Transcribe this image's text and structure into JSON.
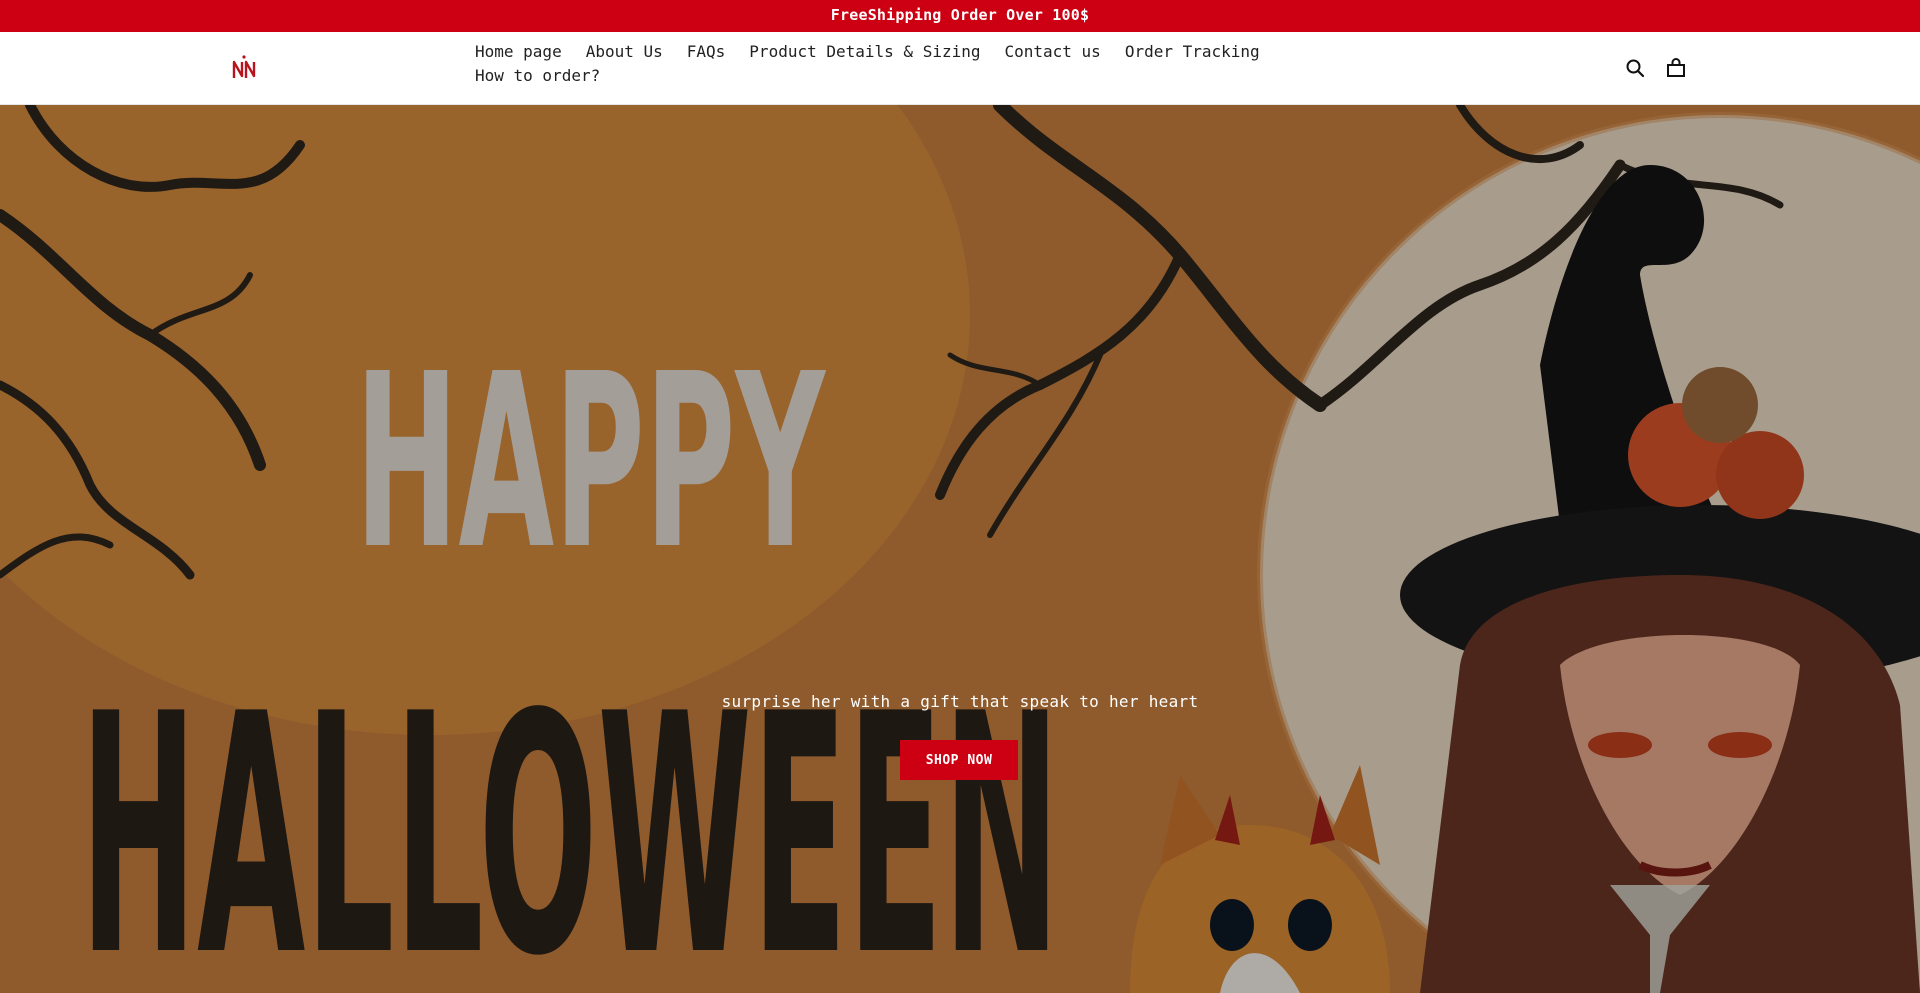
{
  "announcement": {
    "text": "FreeShipping Order Over 100$"
  },
  "header": {
    "nav": [
      {
        "label": "Home page"
      },
      {
        "label": "About Us"
      },
      {
        "label": "FAQs"
      },
      {
        "label": "Product Details & Sizing"
      },
      {
        "label": "Contact us"
      },
      {
        "label": "Order Tracking"
      },
      {
        "label": "How to order?"
      }
    ],
    "icons": {
      "search": "search-icon",
      "cart": "shopping-bag-icon"
    }
  },
  "hero": {
    "headline_top": "HAPPY",
    "headline_bottom": "HALLOWEEN",
    "subtitle": "surprise her with a gift that speak to her heart",
    "cta_label": "SHOP NOW"
  },
  "colors": {
    "brand_red": "#cc0012",
    "hero_orange": "#b0692f",
    "moon_cream": "#e9d8c2",
    "ink": "#222222"
  }
}
